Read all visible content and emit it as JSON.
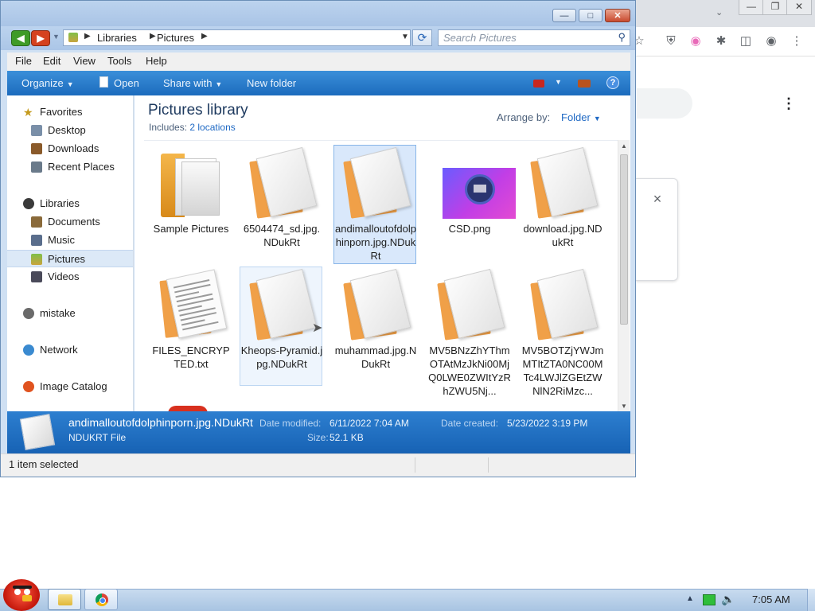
{
  "explorer": {
    "address": {
      "crumbs": [
        "Libraries",
        "Pictures"
      ]
    },
    "search": {
      "placeholder": "Search Pictures"
    },
    "menu": [
      "File",
      "Edit",
      "View",
      "Tools",
      "Help"
    ],
    "commands": {
      "organize": "Organize",
      "open": "Open",
      "share_with": "Share with",
      "new_folder": "New folder"
    },
    "nav": {
      "favorites": {
        "title": "Favorites",
        "items": [
          "Desktop",
          "Downloads",
          "Recent Places"
        ]
      },
      "libraries": {
        "title": "Libraries",
        "items": [
          "Documents",
          "Music",
          "Pictures",
          "Videos"
        ],
        "selected": "Pictures"
      },
      "others": [
        "mistake",
        "Network",
        "Image Catalog"
      ]
    },
    "library": {
      "title": "Pictures library",
      "includes_label": "Includes:",
      "includes_link": "2 locations",
      "arrange_label": "Arrange by:",
      "arrange_value": "Folder"
    },
    "files": [
      {
        "label": "Sample Pictures",
        "kind": "folder"
      },
      {
        "label": "6504474_sd.jpg.NDukRt",
        "kind": "doc"
      },
      {
        "label": "andimalloutofdolphinporn.jpg.NDukRt",
        "kind": "doc",
        "selected": true
      },
      {
        "label": "CSD.png",
        "kind": "image"
      },
      {
        "label": "download.jpg.NDukRt",
        "kind": "doc"
      },
      {
        "label": "FILES_ENCRYPTED.txt",
        "kind": "txt"
      },
      {
        "label": "Kheops-Pyramid.jpg.NDukRt",
        "kind": "doc",
        "hovered": true
      },
      {
        "label": "muhammad.jpg.NDukRt",
        "kind": "doc"
      },
      {
        "label": "MV5BNzZhYThmOTAtMzJkNi00MjQ0LWE0ZWItYzRhZWU5Nj...",
        "kind": "doc"
      },
      {
        "label": "MV5BOTZjYWJmMTItZTA0NC00MTc4LWJlZGEtZWNlN2RiMzc...",
        "kind": "doc"
      }
    ],
    "details": {
      "name": "andimalloutofdolphinporn.jpg.NDukRt",
      "type": "NDUKRT File",
      "modified_label": "Date modified:",
      "modified_value": "6/11/2022 7:04 AM",
      "created_label": "Date created:",
      "created_value": "5/23/2022 3:19 PM",
      "size_label": "Size:",
      "size_value": "52.1 KB"
    },
    "status": "1 item selected"
  },
  "taskbar": {
    "clock": "7:05 AM"
  },
  "colors": {
    "accent": "#1f69c4",
    "command_bar": "#1c6bbd",
    "selection": "#d9e8fb"
  },
  "icons": [
    "back-arrow-icon",
    "forward-arrow-icon",
    "refresh-icon",
    "search-icon",
    "star-icon",
    "folder-icon",
    "library-icon",
    "music-icon",
    "video-icon",
    "network-icon",
    "computer-icon",
    "help-icon",
    "chrome-icon",
    "volume-icon",
    "network-tray-icon"
  ]
}
